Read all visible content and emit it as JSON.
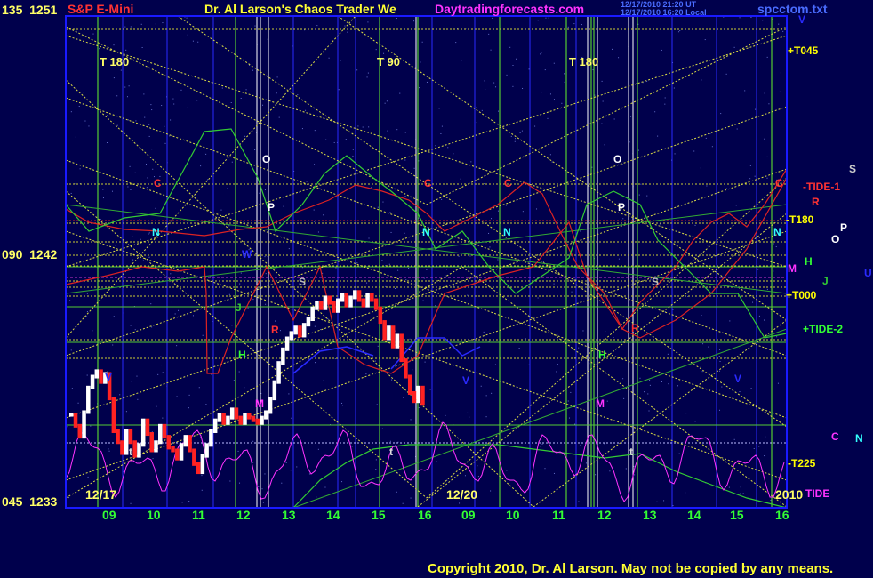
{
  "header": {
    "symbol": "S&P E-Mini",
    "title": "Dr. Al Larson's Chaos Trader We",
    "site": "Daytradingforecasts.com",
    "stamp_utc": "12/17/2010 21:20 UT",
    "stamp_local": "12/17/2010 16:20 Local",
    "file": "spcctom.txt"
  },
  "y_axis": [
    {
      "angle": "135",
      "price": "1251"
    },
    {
      "angle": "090",
      "price": "1242"
    },
    {
      "angle": "045",
      "price": "1233"
    }
  ],
  "dates": [
    "12/17",
    "12/20",
    "2010"
  ],
  "chart_data": {
    "type": "line",
    "title": "Dr. Al Larson's Chaos Trader We",
    "x_ticks": [
      "09",
      "10",
      "11",
      "12",
      "13",
      "14",
      "15",
      "16",
      "09",
      "10",
      "11",
      "12",
      "13",
      "14",
      "15",
      "16"
    ],
    "ylim": [
      1233,
      1251
    ],
    "series_ohlc_close": [
      1236.4,
      1236.0,
      1235.6,
      1236.5,
      1237.4,
      1237.8,
      1238.0,
      1237.6,
      1237.9,
      1237.0,
      1235.8,
      1235.4,
      1235.0,
      1235.8,
      1235.4,
      1234.9,
      1235.3,
      1236.2,
      1235.7,
      1235.1,
      1235.4,
      1236.0,
      1235.6,
      1235.2,
      1235.1,
      1234.8,
      1235.3,
      1235.6,
      1235.1,
      1234.6,
      1234.3,
      1234.9,
      1235.3,
      1235.8,
      1236.2,
      1236.4,
      1236.1,
      1236.3,
      1236.6,
      1236.3,
      1236.1,
      1236.4,
      1236.3,
      1236.2,
      1236.1,
      1236.3,
      1236.5,
      1237.0,
      1237.6,
      1238.3,
      1238.8,
      1239.2,
      1239.4,
      1239.6,
      1239.3,
      1239.7,
      1239.9,
      1240.3,
      1240.5,
      1240.3,
      1240.7,
      1240.5,
      1240.2,
      1240.6,
      1240.8,
      1240.4,
      1240.7,
      1240.9,
      1240.6,
      1240.4,
      1240.8,
      1240.6,
      1240.3,
      1239.8,
      1239.2,
      1239.6,
      1238.9,
      1239.3,
      1238.4,
      1237.8,
      1237.2,
      1236.9,
      1237.4,
      1236.8
    ],
    "labels_right": [
      {
        "text": "+T045",
        "color": "#ffff00"
      },
      {
        "text": "-TIDE-1",
        "color": "#ff3333"
      },
      {
        "text": "-T180",
        "color": "#ffff00"
      },
      {
        "text": "+T000",
        "color": "#ffff00"
      },
      {
        "text": "+TIDE-2",
        "color": "#33ff33"
      },
      {
        "text": "-T225",
        "color": "#ffff00"
      },
      {
        "text": "TIDE",
        "color": "#ff33ff"
      }
    ],
    "time_markers": [
      "T  180",
      "T  90",
      "T  180"
    ],
    "colors": {
      "bg": "#00004c",
      "grid_green": "#33cc33",
      "grid_yellow": "#cccc33",
      "tide": "#ff33ff",
      "red": "#ff2222",
      "blue": "#2a2aff"
    }
  },
  "copyright": "Copyright 2010, Dr. Al Larson. May not be copied by any means."
}
